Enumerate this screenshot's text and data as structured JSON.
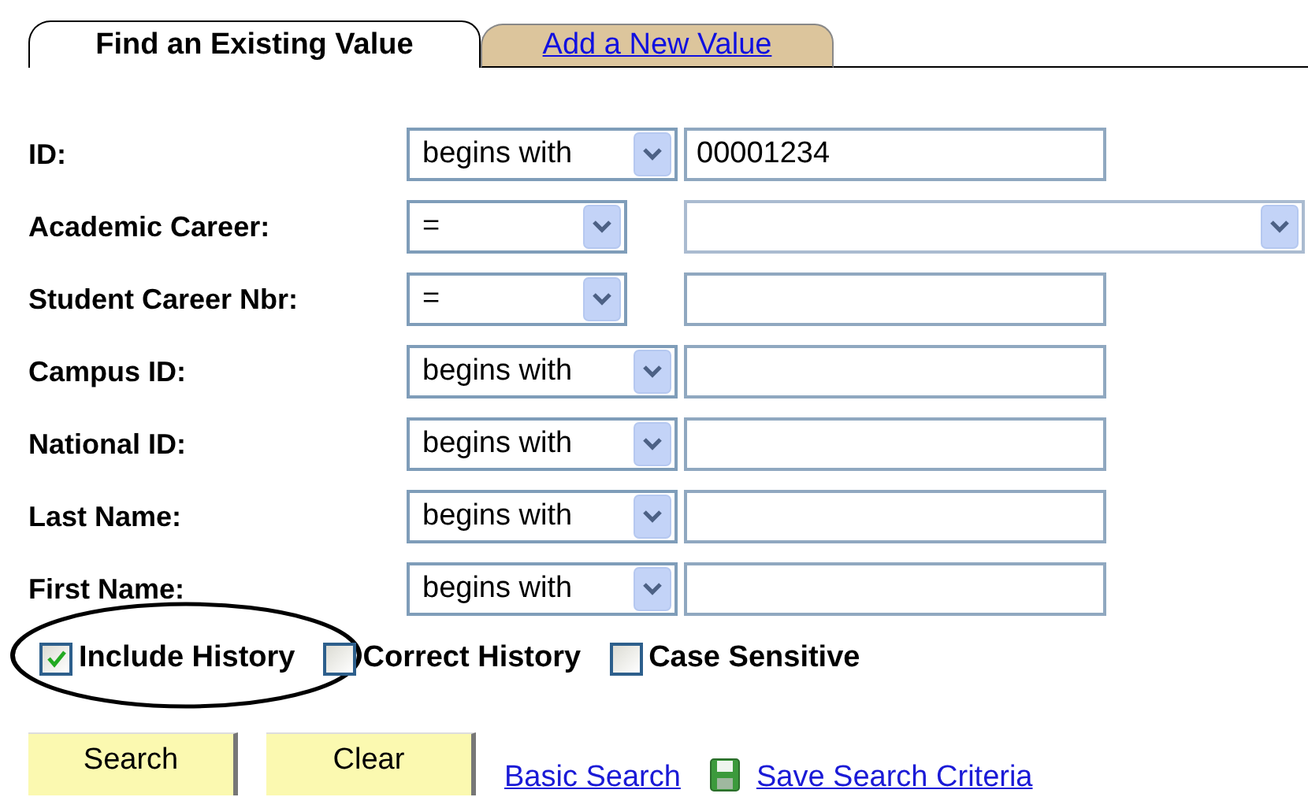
{
  "tabs": [
    {
      "label": "Find an Existing Value",
      "selected": true
    },
    {
      "label": "Add a New Value",
      "selected": false
    }
  ],
  "fields": [
    {
      "label": "ID:",
      "operator": {
        "value": "begins with",
        "kind": "wide"
      },
      "input": {
        "kind": "text",
        "value": "00001234"
      }
    },
    {
      "label": "Academic Career:",
      "operator": {
        "value": "=",
        "kind": "narrow"
      },
      "input": {
        "kind": "select"
      }
    },
    {
      "label": "Student Career Nbr:",
      "operator": {
        "value": "=",
        "kind": "narrow"
      },
      "input": {
        "kind": "text"
      }
    },
    {
      "label": "Campus ID:",
      "operator": {
        "value": "begins with",
        "kind": "wide"
      },
      "input": {
        "kind": "text"
      }
    },
    {
      "label": "National ID:",
      "operator": {
        "value": "begins with",
        "kind": "wide"
      },
      "input": {
        "kind": "text"
      }
    },
    {
      "label": "Last Name:",
      "operator": {
        "value": "begins with",
        "kind": "wide"
      },
      "input": {
        "kind": "text"
      }
    },
    {
      "label": "First Name:",
      "operator": {
        "value": "begins with",
        "kind": "wide"
      },
      "input": {
        "kind": "text"
      }
    }
  ],
  "options": [
    {
      "label": "Include History",
      "checked": true,
      "circled": true
    },
    {
      "label": "Correct History",
      "checked": false,
      "circled": false
    },
    {
      "label": "Case Sensitive",
      "checked": false,
      "circled": false
    }
  ],
  "buttons": [
    "Search",
    "Clear"
  ],
  "links": [
    {
      "label": "Basic Search",
      "kind": "plain"
    },
    {
      "label": "Save Search Criteria",
      "kind": "save"
    }
  ]
}
